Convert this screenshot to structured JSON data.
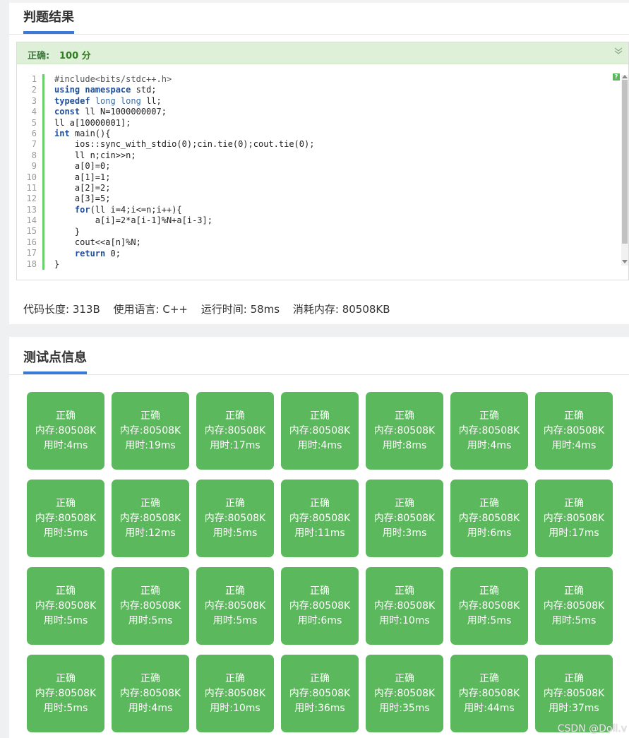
{
  "result_panel": {
    "title": "判题结果",
    "status_label": "正确:",
    "score": "100 分",
    "meta": {
      "code_length": "代码长度: 313B",
      "language": "使用语言: C++",
      "run_time": "运行时间: 58ms",
      "memory": "消耗内存: 80508KB"
    }
  },
  "code": {
    "line_numbers": [
      "1",
      "2",
      "3",
      "4",
      "5",
      "6",
      "7",
      "8",
      "9",
      "10",
      "11",
      "12",
      "13",
      "14",
      "15",
      "16",
      "17",
      "18"
    ],
    "lines": [
      "#include<bits/stdc++.h>",
      "using namespace std;",
      "typedef long long ll;",
      "const ll N=1000000007;",
      "ll a[10000001];",
      "int main(){",
      "    ios::sync_with_stdio(0);cin.tie(0);cout.tie(0);",
      "    ll n;cin>>n;",
      "    a[0]=0;",
      "    a[1]=1;",
      "    a[2]=2;",
      "    a[3]=5;",
      "    for(ll i=4;i<=n;i++){",
      "        a[i]=2*a[i-1]%N+a[i-3];",
      "    }",
      "    cout<<a[n]%N;",
      "    return 0;",
      "}"
    ]
  },
  "tests_panel": {
    "title": "测试点信息",
    "cells": [
      {
        "status": "正确",
        "memory": "内存:80508K",
        "time": "用时:4ms"
      },
      {
        "status": "正确",
        "memory": "内存:80508K",
        "time": "用时:19ms"
      },
      {
        "status": "正确",
        "memory": "内存:80508K",
        "time": "用时:17ms"
      },
      {
        "status": "正确",
        "memory": "内存:80508K",
        "time": "用时:4ms"
      },
      {
        "status": "正确",
        "memory": "内存:80508K",
        "time": "用时:8ms"
      },
      {
        "status": "正确",
        "memory": "内存:80508K",
        "time": "用时:4ms"
      },
      {
        "status": "正确",
        "memory": "内存:80508K",
        "time": "用时:4ms"
      },
      {
        "status": "正确",
        "memory": "内存:80508K",
        "time": "用时:5ms"
      },
      {
        "status": "正确",
        "memory": "内存:80508K",
        "time": "用时:12ms"
      },
      {
        "status": "正确",
        "memory": "内存:80508K",
        "time": "用时:5ms"
      },
      {
        "status": "正确",
        "memory": "内存:80508K",
        "time": "用时:11ms"
      },
      {
        "status": "正确",
        "memory": "内存:80508K",
        "time": "用时:3ms"
      },
      {
        "status": "正确",
        "memory": "内存:80508K",
        "time": "用时:6ms"
      },
      {
        "status": "正确",
        "memory": "内存:80508K",
        "time": "用时:17ms"
      },
      {
        "status": "正确",
        "memory": "内存:80508K",
        "time": "用时:5ms"
      },
      {
        "status": "正确",
        "memory": "内存:80508K",
        "time": "用时:5ms"
      },
      {
        "status": "正确",
        "memory": "内存:80508K",
        "time": "用时:5ms"
      },
      {
        "status": "正确",
        "memory": "内存:80508K",
        "time": "用时:6ms"
      },
      {
        "status": "正确",
        "memory": "内存:80508K",
        "time": "用时:10ms"
      },
      {
        "status": "正确",
        "memory": "内存:80508K",
        "time": "用时:5ms"
      },
      {
        "status": "正确",
        "memory": "内存:80508K",
        "time": "用时:5ms"
      },
      {
        "status": "正确",
        "memory": "内存:80508K",
        "time": "用时:5ms"
      },
      {
        "status": "正确",
        "memory": "内存:80508K",
        "time": "用时:4ms"
      },
      {
        "status": "正确",
        "memory": "内存:80508K",
        "time": "用时:10ms"
      },
      {
        "status": "正确",
        "memory": "内存:80508K",
        "time": "用时:36ms"
      },
      {
        "status": "正确",
        "memory": "内存:80508K",
        "time": "用时:35ms"
      },
      {
        "status": "正确",
        "memory": "内存:80508K",
        "time": "用时:44ms"
      },
      {
        "status": "正确",
        "memory": "内存:80508K",
        "time": "用时:37ms"
      }
    ]
  },
  "watermark": "CSDN @Doll.v",
  "icons": {
    "collapse": "double-chevron-down-icon",
    "help": "help-icon"
  },
  "colors": {
    "accent": "#3c78d8",
    "success_bg": "#dff0d8",
    "success_text": "#3c763d",
    "cell": "#5cb85c"
  }
}
